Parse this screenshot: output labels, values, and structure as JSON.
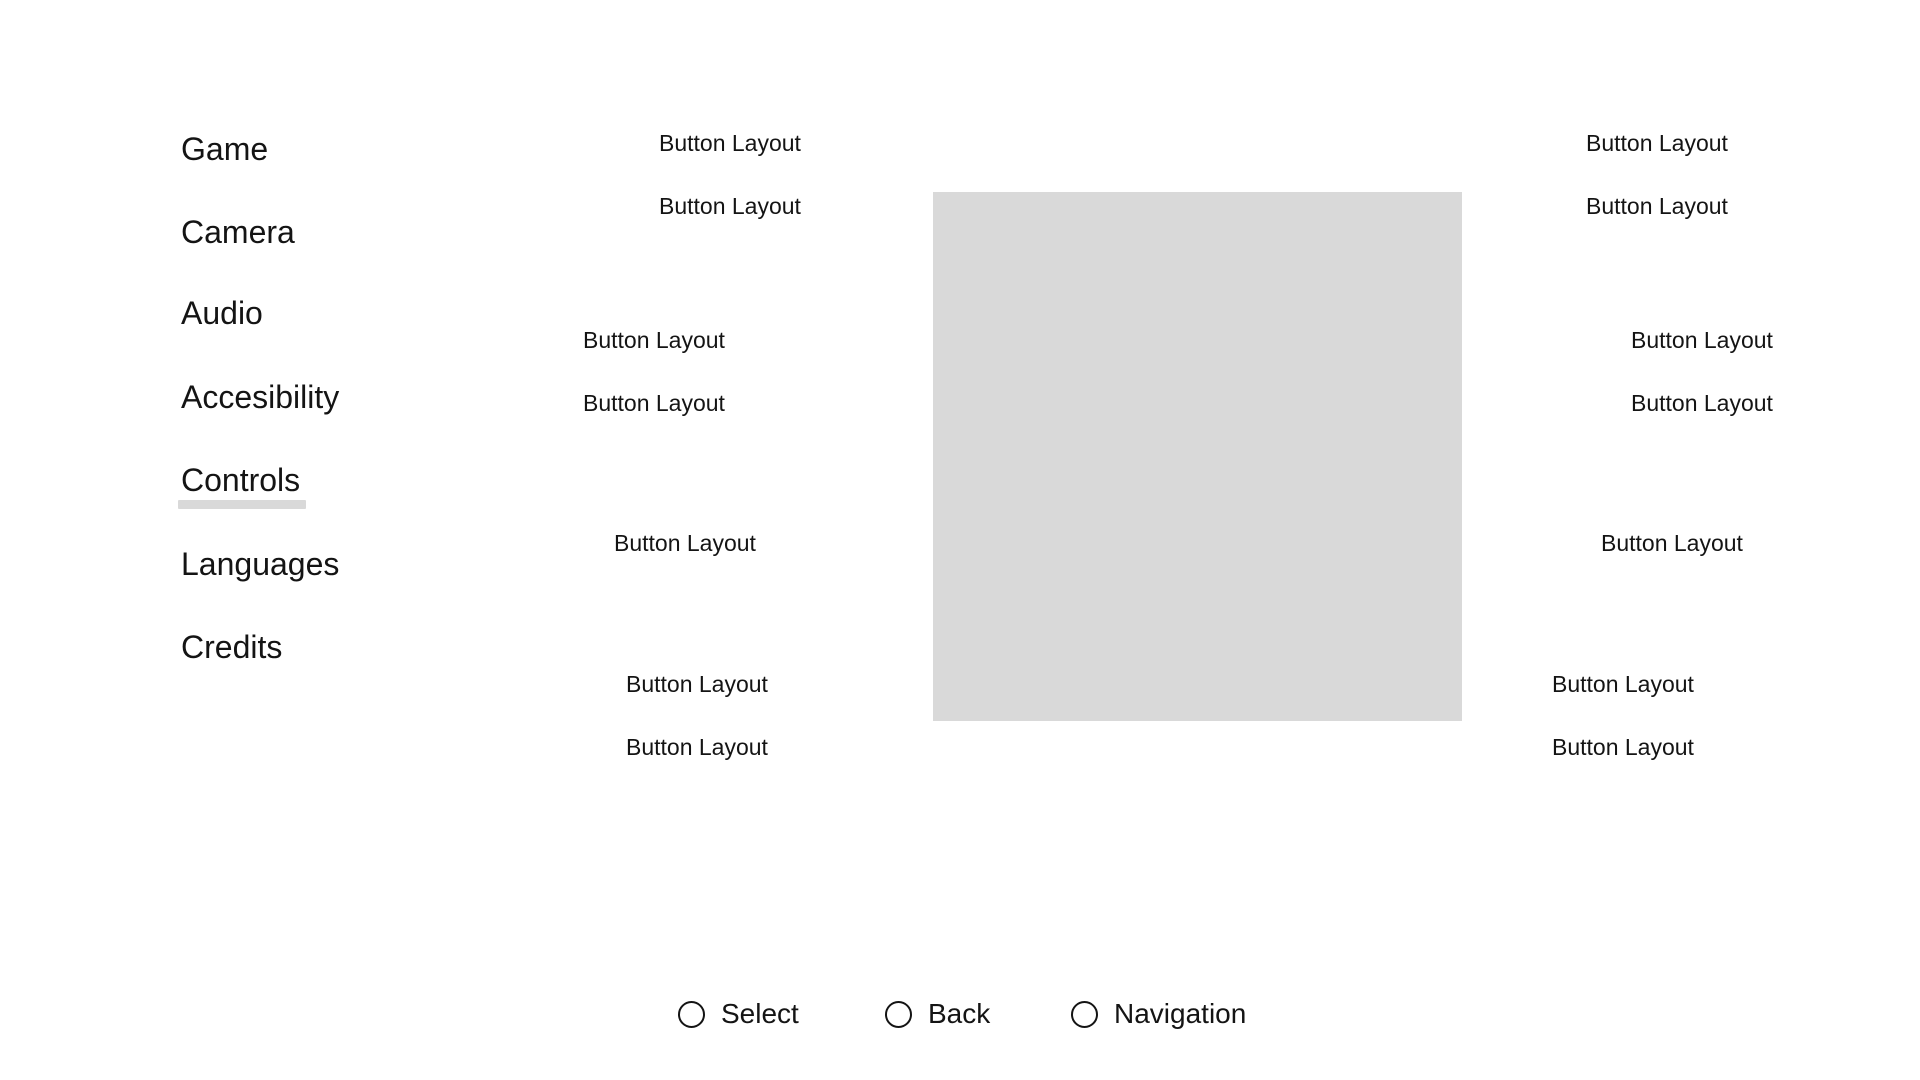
{
  "sidebar": {
    "items": [
      {
        "label": "Game"
      },
      {
        "label": "Camera"
      },
      {
        "label": "Audio"
      },
      {
        "label": "Accesibility"
      },
      {
        "label": "Controls"
      },
      {
        "label": "Languages"
      },
      {
        "label": "Credits"
      }
    ],
    "selected": "Controls"
  },
  "layout": {
    "left_buttons": [
      "Button Layout",
      "Button Layout",
      "Button Layout",
      "Button Layout",
      "Button Layout",
      "Button Layout",
      "Button Layout"
    ],
    "right_buttons": [
      "Button Layout",
      "Button Layout",
      "Button Layout",
      "Button Layout",
      "Button Layout",
      "Button Layout",
      "Button Layout"
    ]
  },
  "footer": {
    "select_label": "Select",
    "back_label": "Back",
    "navigation_label": "Navigation"
  },
  "colors": {
    "selection_underline": "#d9d9d9",
    "preview_panel": "#d9d9d9",
    "text": "#141414",
    "background": "#ffffff"
  }
}
